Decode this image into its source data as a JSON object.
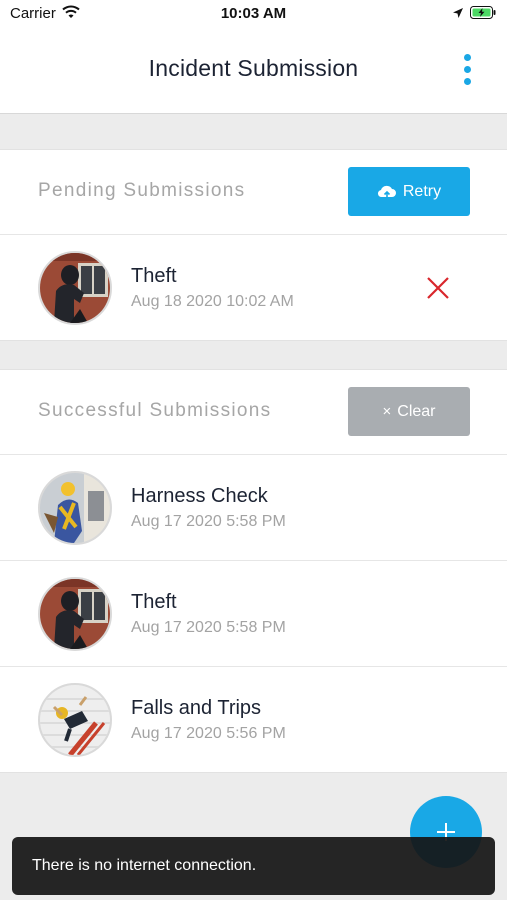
{
  "status_bar": {
    "carrier": "Carrier",
    "time": "10:03 AM",
    "icons": [
      "wifi-icon",
      "location-arrow-icon",
      "battery-charging-icon"
    ]
  },
  "header": {
    "title": "Incident Submission",
    "menu_icon": "more-vertical-icon"
  },
  "pending": {
    "title": "Pending Submissions",
    "retry_label": "Retry",
    "retry_icon": "cloud-upload-icon",
    "items": [
      {
        "title": "Theft",
        "date": "Aug 18 2020 10:02 AM",
        "icon": "theft-photo",
        "delete_icon": "close-icon"
      }
    ]
  },
  "successful": {
    "title": "Successful Submissions",
    "clear_label": "Clear",
    "clear_icon": "×",
    "items": [
      {
        "title": "Harness Check",
        "date": "Aug 17 2020 5:58 PM",
        "icon": "harness-photo"
      },
      {
        "title": "Theft",
        "date": "Aug 17 2020 5:58 PM",
        "icon": "theft-photo"
      },
      {
        "title": "Falls and Trips",
        "date": "Aug 17 2020 5:56 PM",
        "icon": "fall-photo"
      }
    ]
  },
  "fab": {
    "icon": "plus-icon"
  },
  "toast": {
    "message": "There is no internet connection."
  },
  "colors": {
    "accent": "#19a8e6",
    "delete": "#d9262c",
    "clear_button": "#a9adb1",
    "background": "#ececec"
  }
}
